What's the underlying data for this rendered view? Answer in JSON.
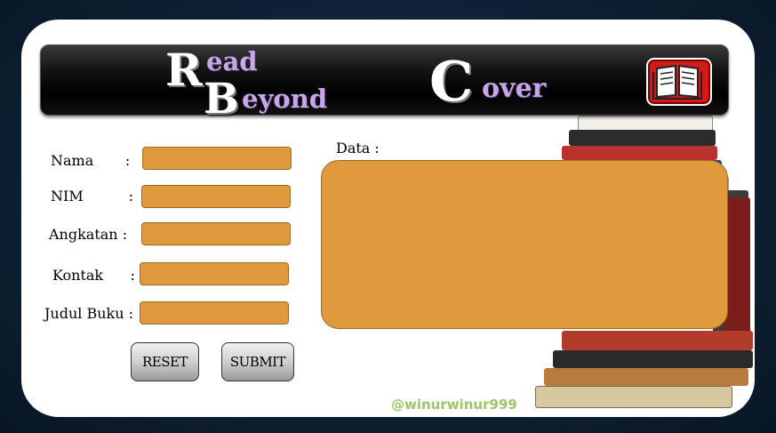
{
  "header": {
    "letter_r": "R",
    "word_ead": "ead",
    "letter_b": "B",
    "word_eyond": "eyond",
    "letter_c": "C",
    "word_over": "over",
    "logo_icon": "open-book-icon"
  },
  "form": {
    "nama_label": "Nama       :",
    "nim_label": "NIM          :",
    "angkatan_label": "Angkatan :",
    "kontak_label": "Kontak      :",
    "judul_label": "Judul Buku :",
    "nama_value": "",
    "nim_value": "",
    "angkatan_value": "",
    "kontak_value": "",
    "judul_value": ""
  },
  "buttons": {
    "reset_label": "RESET",
    "submit_label": "SUBMIT"
  },
  "data_panel": {
    "label": "Data :",
    "value": ""
  },
  "watermark": "@winurwinur999",
  "colors": {
    "field": "#e09a3c",
    "header": "#000000",
    "logo": "#d11a1a",
    "accent_text": "#c6a6e6"
  }
}
